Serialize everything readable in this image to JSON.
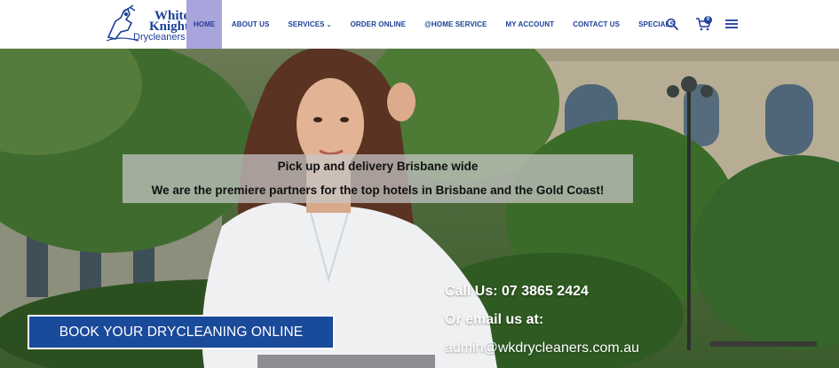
{
  "brand": {
    "logo_line_1": "White",
    "logo_line_2": "Knight",
    "logo_line_3": "Drycleaners",
    "primary_color": "#1b3f97",
    "active_nav_color": "#a8a4dc"
  },
  "nav": {
    "items": [
      {
        "label": "HOME",
        "active": true
      },
      {
        "label": "ABOUT US",
        "active": false
      },
      {
        "label": "SERVICES",
        "active": false,
        "has_dropdown": true
      },
      {
        "label": "ORDER ONLINE",
        "active": false
      },
      {
        "label": "@HOME SERVICE",
        "active": false
      },
      {
        "label": "MY ACCOUNT",
        "active": false
      },
      {
        "label": "CONTACT US",
        "active": false
      },
      {
        "label": "SPECIALS",
        "active": false
      }
    ],
    "caret_icon": "chevron-down-icon",
    "search_icon": "search-icon",
    "cart_icon": "cart-icon",
    "cart_count": "0",
    "menu_icon": "hamburger-menu-icon"
  },
  "hero": {
    "tagline_1": "Pick up and delivery Brisbane wide",
    "tagline_2": "We are the premiere partners for the top hotels in Brisbane and the Gold Coast!",
    "book_button_label": "BOOK YOUR DRYCLEANING ONLINE",
    "phone_text": "Call Us: 07 3865 2424",
    "email_label": "Or email us at:",
    "email": "admin@wkdrycleaners.com.au",
    "button_color": "#1a4a9a"
  }
}
